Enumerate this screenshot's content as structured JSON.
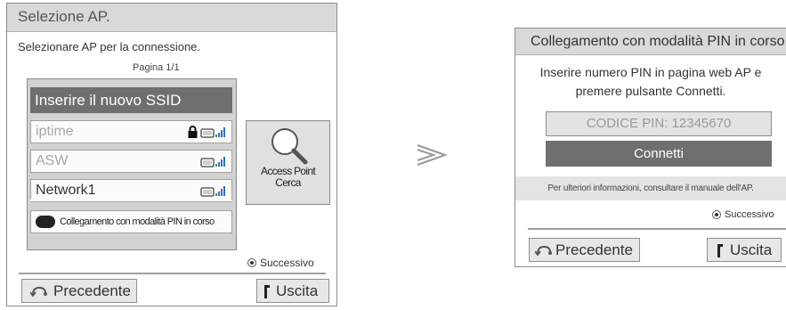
{
  "left_panel": {
    "title": "Selezione AP.",
    "prompt": "Selezionare AP per la connessione.",
    "page": "Pagina 1/1",
    "new_ssid": "Inserire il nuovo SSID",
    "networks": [
      {
        "name": "iptime",
        "locked": true
      },
      {
        "name": "ASW",
        "locked": false
      },
      {
        "name": "Network1",
        "locked": false
      }
    ],
    "pin_mode_button": "Collegamento con modalità PIN in corso",
    "search_button_line1": "Access Point",
    "search_button_line2": "Cerca",
    "next_label": "Successivo",
    "back_label": "Precedente",
    "exit_label": "Uscita"
  },
  "right_panel": {
    "title": "Collegamento con modalità PIN in corso",
    "message_line1": "Inserire numero PIN in pagina web AP e",
    "message_line2": "premere pulsante Connetti.",
    "pin_code": "CODICE PIN: 12345670",
    "connect_button": "Connetti",
    "info": "Per ulteriori informazioni, consultare il manuale dell'AP.",
    "next_label": "Successivo",
    "back_label": "Precedente",
    "exit_label": "Uscita"
  },
  "icons": {
    "lock": "lock-icon",
    "wifi": "wifi-signal-icon",
    "search": "magnifier-icon",
    "back": "back-arrow-icon",
    "exit": "exit-icon",
    "arrow": "next-step-arrow-icon"
  },
  "colors": {
    "title_bar": "#d9d9d9",
    "highlight": "#6f6f6f",
    "signal_green": "#3a9c3a",
    "signal_blue": "#2f6fc8"
  }
}
